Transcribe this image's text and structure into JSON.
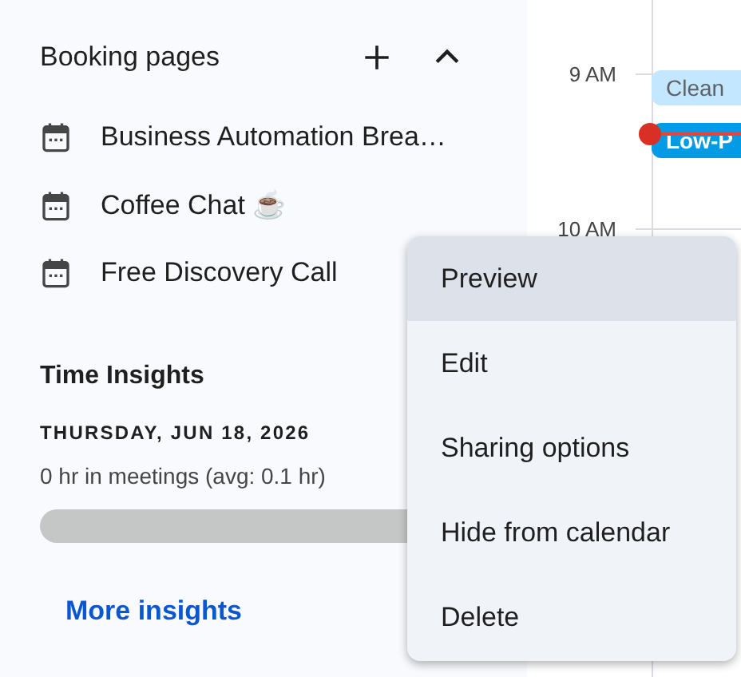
{
  "booking_pages": {
    "title": "Booking pages",
    "expanded": true,
    "items": [
      {
        "label": "Business Automation Brea…"
      },
      {
        "label": "Coffee Chat ☕"
      },
      {
        "label": "Free Discovery Call"
      }
    ]
  },
  "time_insights": {
    "title": "Time Insights",
    "date": "THURSDAY, JUN 18, 2026",
    "summary": "0 hr in meetings (avg: 0.1 hr)",
    "link": "More insights"
  },
  "calendar": {
    "hours": [
      "9 AM",
      "10 AM"
    ],
    "events": [
      {
        "title": "Clean",
        "color": "#c2e7ff"
      },
      {
        "title": "Low-P",
        "color": "#039be5"
      }
    ]
  },
  "context_menu": {
    "items": [
      {
        "label": "Preview",
        "selected": true
      },
      {
        "label": "Edit",
        "selected": false
      },
      {
        "label": "Sharing options",
        "selected": false
      },
      {
        "label": "Hide from calendar",
        "selected": false
      },
      {
        "label": "Delete",
        "selected": false
      }
    ]
  }
}
